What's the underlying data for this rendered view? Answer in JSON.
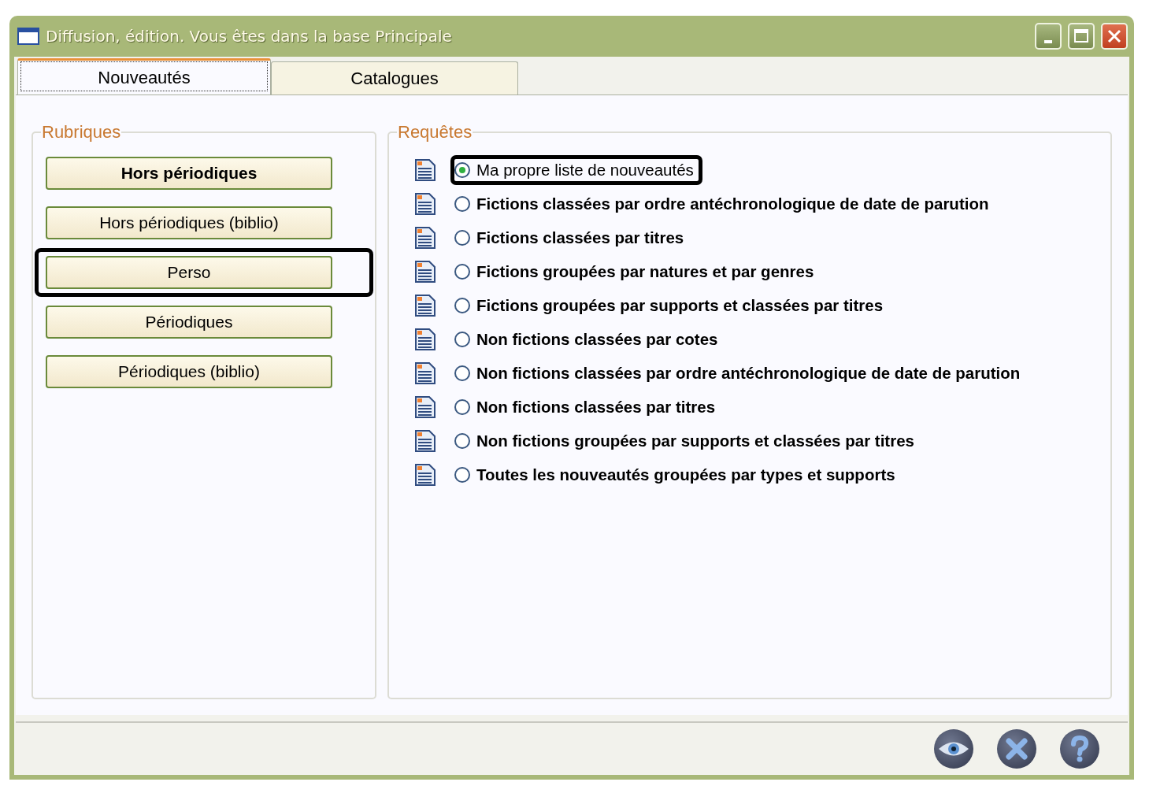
{
  "window": {
    "title": "Diffusion, édition.  Vous êtes dans la base Principale"
  },
  "tabs": [
    {
      "label": "Nouveautés",
      "selected": true
    },
    {
      "label": "Catalogues",
      "selected": false
    }
  ],
  "rubriques": {
    "title": "Rubriques",
    "buttons": [
      {
        "label": "Hors périodiques",
        "bold": true,
        "highlighted": false
      },
      {
        "label": "Hors périodiques (biblio)",
        "bold": false,
        "highlighted": false
      },
      {
        "label": "Perso",
        "bold": false,
        "highlighted": true
      },
      {
        "label": "Périodiques",
        "bold": false,
        "highlighted": false
      },
      {
        "label": "Périodiques (biblio)",
        "bold": false,
        "highlighted": false
      }
    ]
  },
  "requetes": {
    "title": "Requêtes",
    "items": [
      {
        "label": "Ma propre liste de nouveautés",
        "selected": true,
        "bold": false,
        "highlighted": true
      },
      {
        "label": "Fictions classées par ordre antéchronologique de date de parution",
        "selected": false,
        "bold": true,
        "highlighted": false
      },
      {
        "label": "Fictions classées par titres",
        "selected": false,
        "bold": true,
        "highlighted": false
      },
      {
        "label": "Fictions groupées par natures et par genres",
        "selected": false,
        "bold": true,
        "highlighted": false
      },
      {
        "label": "Fictions groupées par supports et classées par titres",
        "selected": false,
        "bold": true,
        "highlighted": false
      },
      {
        "label": "Non fictions classées par cotes",
        "selected": false,
        "bold": true,
        "highlighted": false
      },
      {
        "label": "Non fictions classées par ordre antéchronologique de date de parution",
        "selected": false,
        "bold": true,
        "highlighted": false
      },
      {
        "label": "Non fictions classées par titres",
        "selected": false,
        "bold": true,
        "highlighted": false
      },
      {
        "label": "Non fictions groupées par supports et classées par titres",
        "selected": false,
        "bold": true,
        "highlighted": false
      },
      {
        "label": "Toutes les nouveautés groupées par types et supports",
        "selected": false,
        "bold": true,
        "highlighted": false
      }
    ]
  }
}
